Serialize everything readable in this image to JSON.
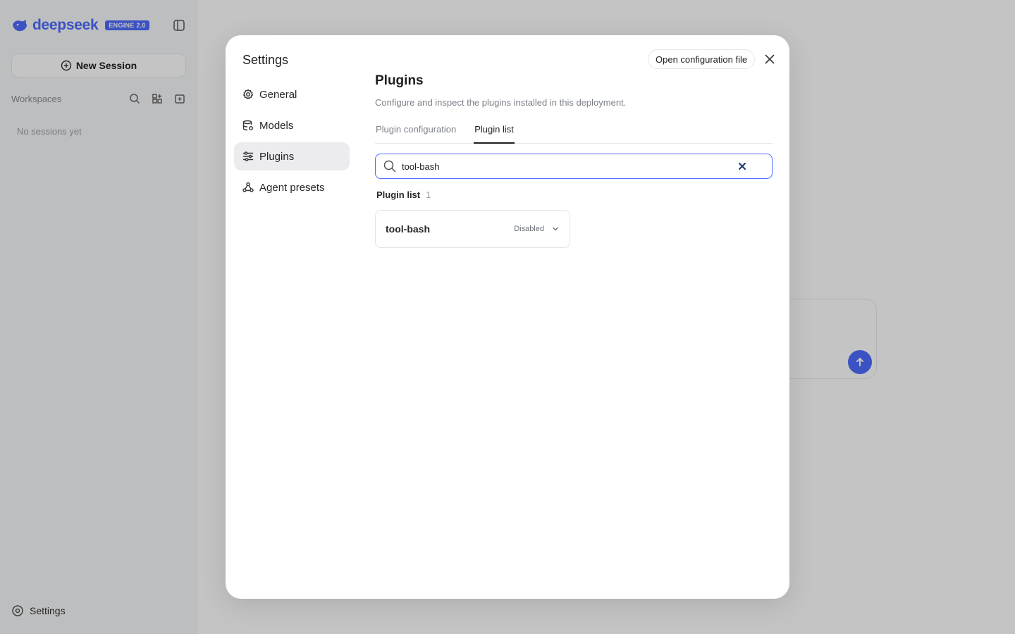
{
  "app": {
    "brand_name": "deepseek",
    "brand_tag": "ENGINE 2.0",
    "new_session_label": "New Session",
    "workspaces_label": "Workspaces",
    "no_sessions_text": "No sessions yet",
    "settings_label": "Settings",
    "accent_color": "#4d6bfe"
  },
  "modal": {
    "title": "Settings",
    "open_config_label": "Open configuration file",
    "nav": [
      {
        "label": "General",
        "icon": "gear-icon"
      },
      {
        "label": "Models",
        "icon": "database-icon"
      },
      {
        "label": "Plugins",
        "icon": "sliders-icon",
        "active": true
      },
      {
        "label": "Agent presets",
        "icon": "presets-icon"
      }
    ]
  },
  "plugins": {
    "title": "Plugins",
    "description": "Configure and inspect the plugins installed in this deployment.",
    "tabs": [
      {
        "label": "Plugin configuration"
      },
      {
        "label": "Plugin list",
        "active": true
      }
    ],
    "search": {
      "value": "tool-bash"
    },
    "list_label": "Plugin list",
    "list_count": "1",
    "items": [
      {
        "name": "tool-bash",
        "status": "Disabled"
      }
    ]
  }
}
